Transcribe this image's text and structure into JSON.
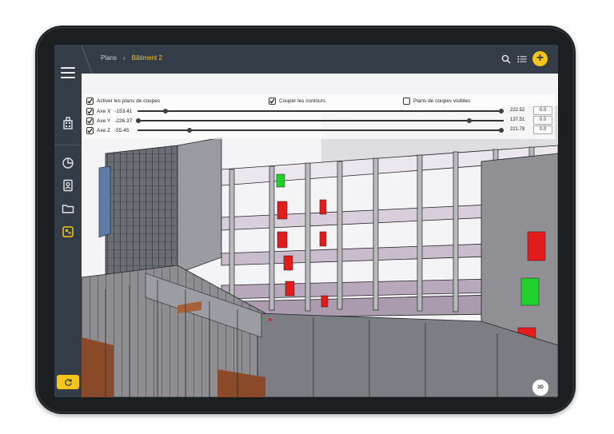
{
  "breadcrumb": {
    "root": "Plans",
    "separator": "›",
    "current": "Bâtiment 2"
  },
  "clipping": {
    "activate_label": "Activer les plans de coupes",
    "activate_checked": true,
    "cut_contours_label": "Couper les contours",
    "cut_contours_checked": true,
    "visible_planes_label": "Plans de coupes visibles",
    "visible_planes_checked": false,
    "axes": [
      {
        "label": "Axe X",
        "start": "-153.41",
        "end": "222.52",
        "offset": "0.0",
        "checked": true
      },
      {
        "label": "Axe Y",
        "start": "-226.37",
        "end": "137.51",
        "offset": "0.0",
        "checked": true
      },
      {
        "label": "Axe Z",
        "start": "-55.45",
        "end": "221.78",
        "offset": "0.0",
        "checked": true
      }
    ]
  },
  "view_toggle": {
    "label": "3D"
  },
  "icons": {
    "menu": "hamburger-icon",
    "building": "building-icon",
    "stats": "pie-chart-icon",
    "contacts": "contacts-icon",
    "folder": "folder-icon",
    "model": "model-icon",
    "refresh": "refresh-icon",
    "search": "search-icon",
    "list": "list-icon",
    "add": "plus-icon"
  },
  "colors": {
    "accent": "#f5c518",
    "sidebar": "#343d47",
    "clash_red": "#e51b1b",
    "clash_green": "#21d12b"
  }
}
